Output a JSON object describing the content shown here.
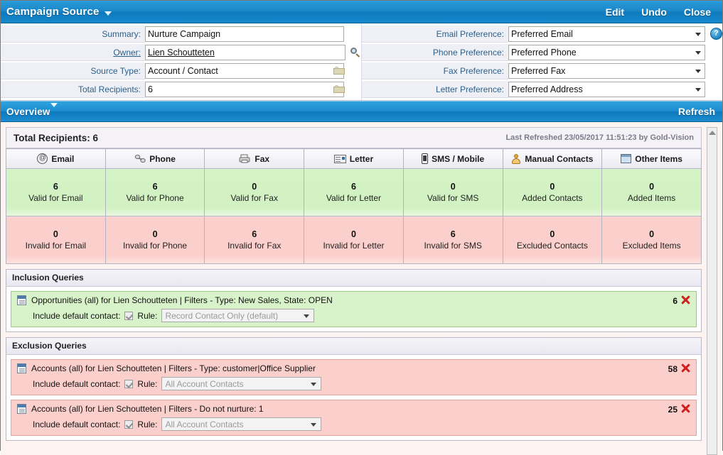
{
  "header": {
    "title": "Campaign Source",
    "actions": [
      "Edit",
      "Undo",
      "Close"
    ],
    "edit": "Edit",
    "undo": "Undo",
    "close": "Close"
  },
  "form": {
    "left": [
      {
        "label": "Summary:",
        "value": "Nurture Campaign",
        "type": "text",
        "readonly": false
      },
      {
        "label": "Owner:",
        "value": "Lien Schoutteten",
        "type": "lookup",
        "readonly": false
      },
      {
        "label": "Source Type:",
        "value": "Account / Contact",
        "type": "locked",
        "readonly": true
      },
      {
        "label": "Total Recipients:",
        "value": "6",
        "type": "locked",
        "readonly": true
      }
    ],
    "right": [
      {
        "label": "Email Preference:",
        "value": "Preferred Email",
        "type": "select"
      },
      {
        "label": "Phone Preference:",
        "value": "Preferred Phone",
        "type": "select"
      },
      {
        "label": "Fax Preference:",
        "value": "Preferred Fax",
        "type": "select"
      },
      {
        "label": "Letter Preference:",
        "value": "Preferred Address",
        "type": "select"
      }
    ]
  },
  "overview": {
    "title": "Overview",
    "refresh": "Refresh",
    "total_recipients": "Total Recipients: 6",
    "last_refreshed": "Last Refreshed 23/05/2017 11:51:23 by Gold-Vision"
  },
  "stats": {
    "columns": [
      {
        "label": "Email",
        "icon": "at-icon"
      },
      {
        "label": "Phone",
        "icon": "phone-icon"
      },
      {
        "label": "Fax",
        "icon": "fax-icon"
      },
      {
        "label": "Letter",
        "icon": "letter-icon"
      },
      {
        "label": "SMS / Mobile",
        "icon": "mobile-icon"
      },
      {
        "label": "Manual Contacts",
        "icon": "person-icon"
      },
      {
        "label": "Other Items",
        "icon": "window-icon"
      }
    ],
    "valid_row": [
      {
        "count": "6",
        "label": "Valid for Email"
      },
      {
        "count": "6",
        "label": "Valid for Phone"
      },
      {
        "count": "0",
        "label": "Valid for Fax"
      },
      {
        "count": "6",
        "label": "Valid for Letter"
      },
      {
        "count": "0",
        "label": "Valid for SMS"
      },
      {
        "count": "0",
        "label": "Added Contacts"
      },
      {
        "count": "0",
        "label": "Added Items"
      }
    ],
    "invalid_row": [
      {
        "count": "0",
        "label": "Invalid for Email"
      },
      {
        "count": "0",
        "label": "Invalid for Phone"
      },
      {
        "count": "6",
        "label": "Invalid for Fax"
      },
      {
        "count": "0",
        "label": "Invalid for Letter"
      },
      {
        "count": "6",
        "label": "Invalid for SMS"
      },
      {
        "count": "0",
        "label": "Excluded Contacts"
      },
      {
        "count": "0",
        "label": "Excluded Items"
      }
    ]
  },
  "inclusion": {
    "heading": "Inclusion Queries",
    "rows": [
      {
        "text": "Opportunities (all) for Lien Schoutteten | Filters - Type: New Sales, State: OPEN",
        "contact_label": "Include default contact:",
        "rule_label": "Rule:",
        "rule_value": "Record Contact Only (default)",
        "count": "6"
      }
    ]
  },
  "exclusion": {
    "heading": "Exclusion Queries",
    "rows": [
      {
        "text": "Accounts (all) for Lien Schoutteten | Filters - Type: customer|Office Supplier",
        "contact_label": "Include default contact:",
        "rule_label": "Rule:",
        "rule_value": "All Account Contacts",
        "count": "58"
      },
      {
        "text": "Accounts (all) for Lien Schoutteten | Filters - Do not nurture: 1",
        "contact_label": "Include default contact:",
        "rule_label": "Rule:",
        "rule_value": "All Account Contacts",
        "count": "25"
      }
    ]
  },
  "colors": {
    "header_blue": "#1a86c8",
    "valid_green": "#d2f2c3",
    "invalid_red": "#fbcfcb",
    "delete_red": "#d01f1f",
    "label_text": "#2c5f8a"
  }
}
